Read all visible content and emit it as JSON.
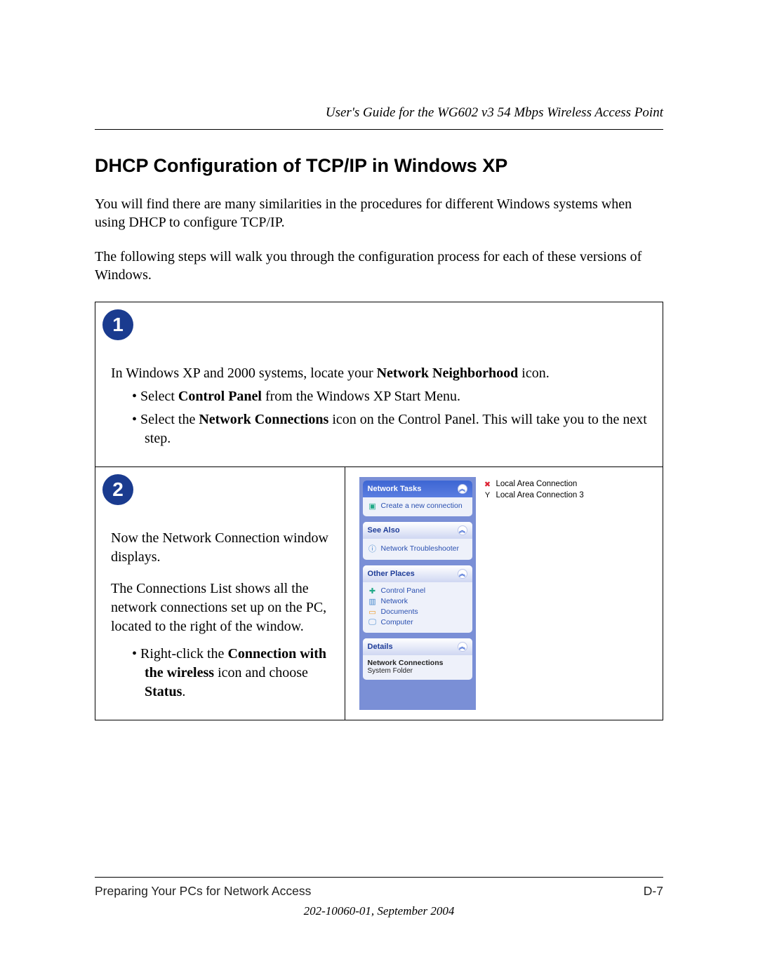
{
  "header": {
    "doc_title": "User's Guide for the WG602 v3 54 Mbps Wireless Access Point"
  },
  "title": "DHCP Configuration of TCP/IP in Windows XP",
  "intro_p1": "You will find there are many similarities in the procedures for different Windows systems when using DHCP to configure TCP/IP.",
  "intro_p2": "The following steps will walk you through the configuration process for each of these versions of Windows.",
  "step1": {
    "num": "1",
    "lead_a": "In Windows XP and 2000 systems, locate your ",
    "lead_b_bold": "Network Neighborhood",
    "lead_c": " icon.",
    "b1_a": "Select ",
    "b1_b_bold": "Control Panel",
    "b1_c": " from the Windows XP Start Menu.",
    "b2_a": "Select the ",
    "b2_b_bold": "Network Connections",
    "b2_c": " icon on the Control Panel.  This will take you to the next step."
  },
  "step2": {
    "num": "2",
    "p1": "Now the Network Connection window displays.",
    "p2": "The Connections List shows all the network connections set up on the PC, located to the right of the window.",
    "b1_a": "Right-click the ",
    "b1_b_bold": "Connection with the wireless",
    "b1_c": " icon and choose ",
    "b1_d_bold": "Status",
    "b1_e": "."
  },
  "xp": {
    "tasks_head": "Network Tasks",
    "tasks_item": "Create a new connection",
    "see_also_head": "See Also",
    "see_also_item": "Network Troubleshooter",
    "other_head": "Other Places",
    "other_items": [
      "Control Panel",
      "Network",
      "Documents",
      "Computer"
    ],
    "details_head": "Details",
    "details_title": "Network Connections",
    "details_sub": "System Folder",
    "conn1": "Local Area Connection",
    "conn2": "Local Area Connection 3"
  },
  "footer": {
    "section": "Preparing Your PCs for Network Access",
    "page": "D-7",
    "date": "202-10060-01, September 2004"
  }
}
